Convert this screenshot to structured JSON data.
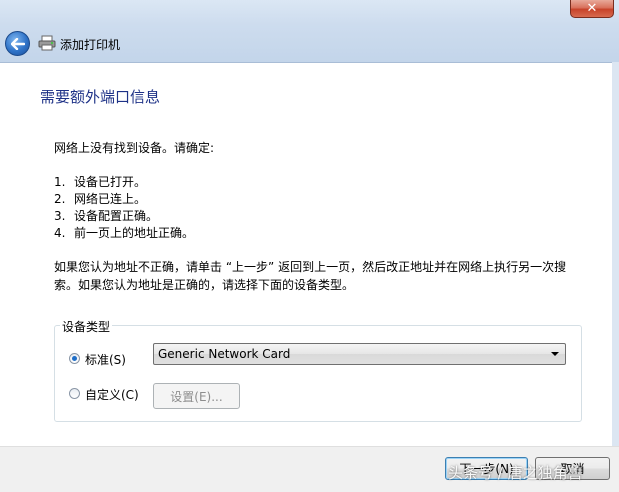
{
  "window": {
    "close_glyph": "✕",
    "header_title": "添加打印机"
  },
  "page": {
    "heading": "需要额外端口信息",
    "intro": "网络上没有找到设备。请确定:",
    "checklist": [
      {
        "num": "1.",
        "text": "设备已打开。"
      },
      {
        "num": "2.",
        "text": "网络已连上。"
      },
      {
        "num": "3.",
        "text": "设备配置正确。"
      },
      {
        "num": "4.",
        "text": "前一页上的地址正确。"
      }
    ],
    "paragraph": "如果您认为地址不正确，请单击 “上一步” 返回到上一页，然后改正地址并在网络上执行另一次搜索。如果您认为地址是正确的，请选择下面的设备类型。"
  },
  "device_type": {
    "group_label": "设备类型",
    "standard_label": "标准(S)",
    "standard_selected": true,
    "standard_value": "Generic Network Card",
    "custom_label": "自定义(C)",
    "custom_selected": false,
    "settings_button": "设置(E)..."
  },
  "footer": {
    "next_button": "下一步(N)",
    "cancel_button": "取消"
  },
  "watermark": "头条号 / 唐之独角兽",
  "colors": {
    "heading": "#1e3287",
    "accent": "#1e6ec8"
  }
}
